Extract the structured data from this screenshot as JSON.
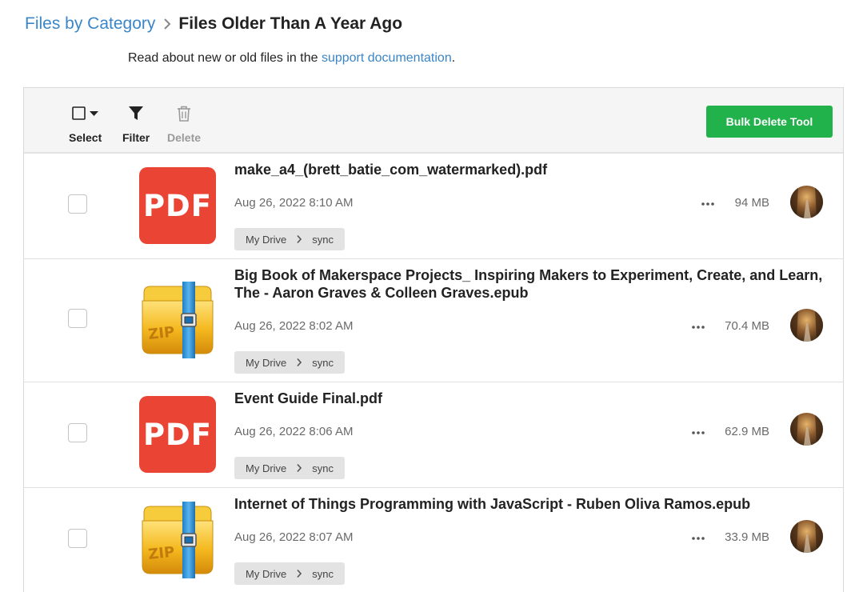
{
  "breadcrumb": {
    "parent": "Files by Category",
    "current": "Files Older Than A Year Ago"
  },
  "help": {
    "prefix": "Read about new or old files in the ",
    "link": "support documentation",
    "suffix": "."
  },
  "toolbar": {
    "select_label": "Select",
    "filter_label": "Filter",
    "delete_label": "Delete",
    "bulk_delete_label": "Bulk Delete Tool"
  },
  "colors": {
    "link": "#3b86c7",
    "bulk_button": "#21b24b",
    "pdf_icon": "#ea4435"
  },
  "files": [
    {
      "name": "make_a4_(brett_batie_com_watermarked).pdf",
      "type_icon": "pdf-icon",
      "icon_text": "PDF",
      "date": "Aug 26, 2022 8:10 AM",
      "size": "94 MB",
      "path": [
        "My Drive",
        "sync"
      ]
    },
    {
      "name": "Big Book of Makerspace Projects_ Inspiring Makers to Experiment, Create, and Learn, The - Aaron Graves & Colleen Graves.epub",
      "type_icon": "zip-icon",
      "icon_text": "ZIP",
      "date": "Aug 26, 2022 8:02 AM",
      "size": "70.4 MB",
      "path": [
        "My Drive",
        "sync"
      ]
    },
    {
      "name": "Event Guide Final.pdf",
      "type_icon": "pdf-icon",
      "icon_text": "PDF",
      "date": "Aug 26, 2022 8:06 AM",
      "size": "62.9 MB",
      "path": [
        "My Drive",
        "sync"
      ]
    },
    {
      "name": "Internet of Things Programming with JavaScript - Ruben Oliva Ramos.epub",
      "type_icon": "zip-icon",
      "icon_text": "ZIP",
      "date": "Aug 26, 2022 8:07 AM",
      "size": "33.9 MB",
      "path": [
        "My Drive",
        "sync"
      ]
    }
  ]
}
